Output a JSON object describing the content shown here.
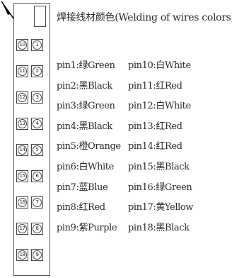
{
  "title": "焊接线材颜色(Welding of wires colors)",
  "connector_rows": [
    {
      "left": "10",
      "right": "1"
    },
    {
      "left": "11",
      "right": "2"
    },
    {
      "left": "12",
      "right": "3"
    },
    {
      "left": "13",
      "right": "4"
    },
    {
      "left": "14",
      "right": "5"
    },
    {
      "left": "15",
      "right": "6"
    },
    {
      "left": "16",
      "right": "7"
    },
    {
      "left": "17",
      "right": "8"
    },
    {
      "left": "18",
      "right": "9"
    }
  ],
  "pins_left": [
    "pin1:绿Green",
    "pin2:黑Black",
    "pin3:绿Green",
    "pin4:黑Black",
    "pin5:橙Orange",
    "pin6:白White",
    "pin7:蓝Blue",
    "pin8:红Red",
    "pin9:紫Purple"
  ],
  "pins_right": [
    "pin10:白White",
    "pin11:红Red",
    "pin12:白White",
    "pin13:红Red",
    "pin14:红Red",
    "pin15:黑Black",
    "pin16:绿Green",
    "pin17:黄Yellow",
    "pin18:黑Black"
  ]
}
